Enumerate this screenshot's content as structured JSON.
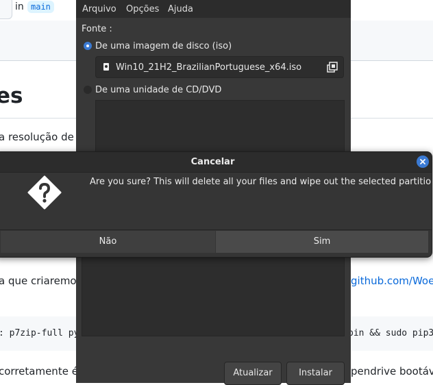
{
  "background_page": {
    "repo_in": "in",
    "branch": "main",
    "heading": "es",
    "para1": "a resolução de p",
    "para2": "a que criaremos",
    "link_fragment": "github.com/WoeU",
    "code_left": ": p7zip-full py",
    "code_right": "pin && sudo pip3",
    "para3": "corretamente é",
    "para3_right": "pendrive bootáve"
  },
  "app": {
    "menu": [
      "Arquivo",
      "Opções",
      "Ajuda"
    ],
    "source_label": "Fonte :",
    "source_options": {
      "iso_label": "De uma imagem de disco (iso)",
      "iso_selected": true,
      "cd_label": "De uma unidade de CD/DVD",
      "cd_selected": false
    },
    "selected_file": "Win10_21H2_BrazilianPortuguese_x64.iso",
    "buttons": {
      "refresh": "Atualizar",
      "install": "Instalar"
    }
  },
  "dialog": {
    "title": "Cancelar",
    "message": "Are you sure? This will delete all your files and wipe out the selected partition.",
    "no_label": "Não",
    "yes_label": "Sim",
    "accent": "#3b7ad3",
    "icons": [
      "question-icon",
      "close-icon"
    ]
  }
}
